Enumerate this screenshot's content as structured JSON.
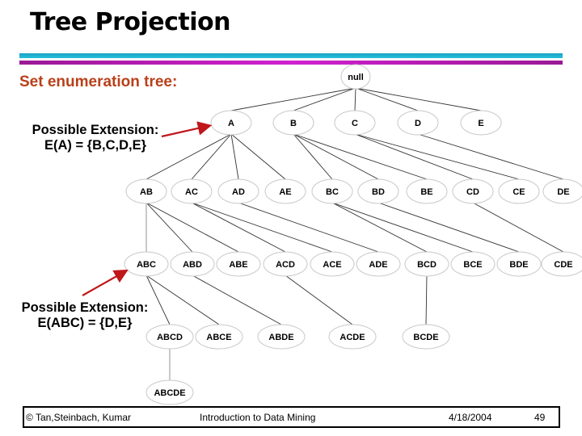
{
  "slide": {
    "title": "Tree Projection",
    "subtitle": "Set enumeration tree:",
    "annotations": [
      {
        "line1": "Possible Extension:",
        "line2": "E(A) = {B,C,D,E}",
        "points_to": "A"
      },
      {
        "line1": "Possible Extension:",
        "line2": "E(ABC) = {D,E}",
        "points_to": "ABC"
      }
    ],
    "colors": {
      "subtitle": "#b8401a",
      "arrow": "#c0171b",
      "rule_top": "#1fb2d0",
      "rule_bottom": "#c020c0"
    }
  },
  "tree": {
    "root": "null",
    "levels": [
      [
        "A",
        "B",
        "C",
        "D",
        "E"
      ],
      [
        "AB",
        "AC",
        "AD",
        "AE",
        "BC",
        "BD",
        "BE",
        "CD",
        "CE",
        "DE"
      ],
      [
        "ABC",
        "ABD",
        "ABE",
        "ACD",
        "ACE",
        "ADE",
        "BCD",
        "BCE",
        "BDE",
        "CDE"
      ],
      [
        "ABCD",
        "ABCE",
        "ABDE",
        "ACDE",
        "BCDE"
      ],
      [
        "ABCDE"
      ]
    ]
  },
  "footer": {
    "copyright": "© Tan,Steinbach, Kumar",
    "course": "Introduction to Data Mining",
    "date": "4/18/2004",
    "page": "49"
  }
}
